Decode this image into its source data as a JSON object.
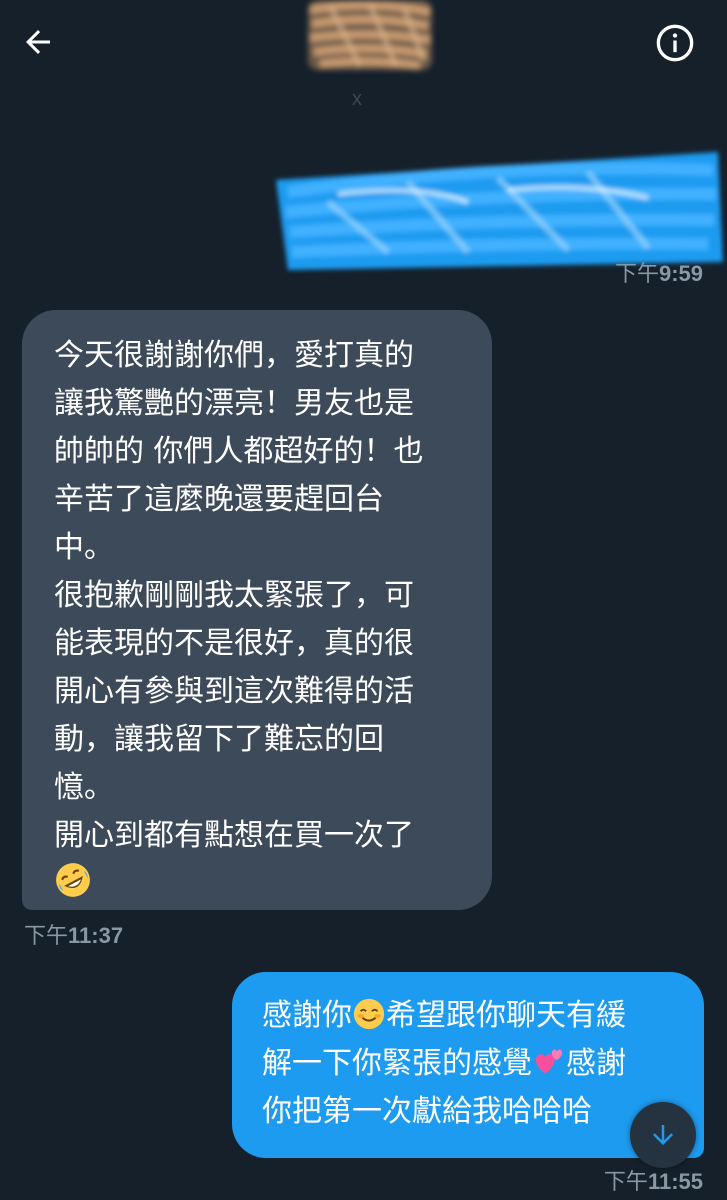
{
  "header": {
    "back_icon": "arrow-left-icon",
    "info_icon": "info-circle-icon",
    "x_mark": "x"
  },
  "messages": [
    {
      "direction": "sent",
      "redacted": true,
      "timestamp_prefix": "下午",
      "timestamp_time": "9:59"
    },
    {
      "direction": "received",
      "lines": [
        "今天很謝謝你們，愛打真的",
        "讓我驚艷的漂亮！男友也是",
        "帥帥的 你們人都超好的！也",
        "辛苦了這麼晚還要趕回台",
        "中。",
        "很抱歉剛剛我太緊張了，可",
        "能表現的不是很好，真的很",
        "開心有參與到這次難得的活",
        "動，讓我留下了難忘的回",
        "憶。",
        "開心到都有點想在買一次了"
      ],
      "emoji_end": "rolling-on-floor-laughing-emoji",
      "timestamp_prefix": "下午",
      "timestamp_time": "11:37"
    },
    {
      "direction": "sent",
      "part1": "感謝你",
      "emoji1": "smiling-face-emoji",
      "part2": "希望跟你聊天有緩",
      "part3": "解一下你緊張的感覺",
      "emoji2": "two-hearts-emoji",
      "part4": "感謝",
      "part5": "你把第一次獻給我哈哈哈",
      "timestamp_prefix": "下午",
      "timestamp_time": "11:55"
    }
  ],
  "colors": {
    "background": "#15202b",
    "received_bubble": "#3d4a59",
    "sent_bubble": "#1d9bf0",
    "timestamp": "#8899a6"
  },
  "fab": {
    "icon": "arrow-down-icon"
  }
}
